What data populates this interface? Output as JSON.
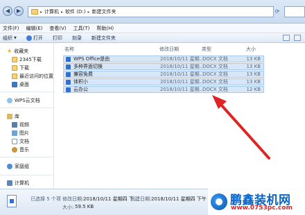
{
  "address": {
    "segments": [
      "计算机",
      "软件 (D:)",
      "新建文件夹"
    ]
  },
  "menu": [
    "文件(F)",
    "编辑(E)",
    "查看(V)",
    "工具(T)",
    "帮助(H)"
  ],
  "toolbar": {
    "organize": "组织",
    "open": "打开",
    "print": "打印",
    "burn": "刻录",
    "new_folder": "新建文件夹"
  },
  "sidebar": {
    "favorites": "收藏夹",
    "downloads_2345": "2345下载",
    "downloads": "下载",
    "recent": "最近访问的位置",
    "desktop": "桌面",
    "wps_cloud": "WPS云文档",
    "library": "库",
    "videos": "视频",
    "pictures": "图片",
    "documents": "文档",
    "music": "音乐",
    "homegroup": "家庭组",
    "computer": "计算机"
  },
  "columns": {
    "name": "名称",
    "date": "修改日期",
    "type": "类型",
    "size": "大小"
  },
  "files": [
    {
      "name": "WPS Office是由",
      "date": "2018/10/11 星期...",
      "type": "DOCX 文档",
      "size": "13 KB"
    },
    {
      "name": "多种界面切换",
      "date": "2018/10/11 星期...",
      "type": "DOCX 文档",
      "size": "13 KB"
    },
    {
      "name": "兼容免费",
      "date": "2018/10/11 星期...",
      "type": "DOCX 文档",
      "size": "13 KB"
    },
    {
      "name": "体积小",
      "date": "2018/10/11 星期...",
      "type": "DOCX 文档",
      "size": "13 KB"
    },
    {
      "name": "云办公",
      "date": "2018/10/11 星期...",
      "type": "DOCX 文档",
      "size": "12 KB"
    }
  ],
  "details": {
    "selected": "已选择 5 个项",
    "modified_label": "修改日期:",
    "modified_value": "2018/10/11 星期四 下...",
    "created_label": "创建日期:",
    "created_value": "2018/10/11 星期四 下午 ...",
    "size_label": "大小:",
    "size_value": "59.5 KB"
  },
  "watermark": {
    "title": "鹏鑫装机网",
    "url": "www.0753pc.com"
  },
  "colors": {
    "selection": "#d7e7f8",
    "arrow": "#e02424"
  }
}
